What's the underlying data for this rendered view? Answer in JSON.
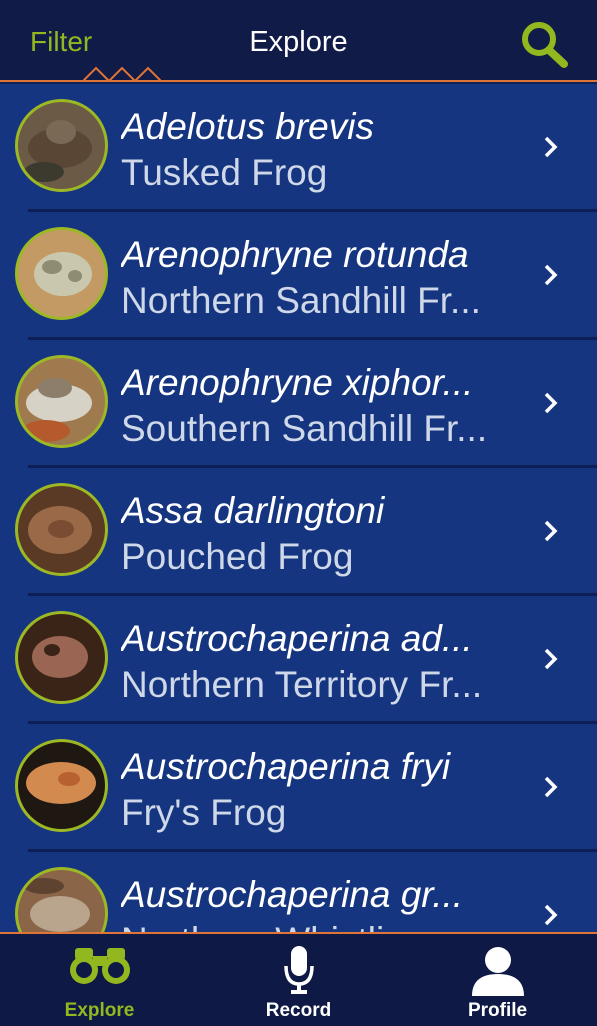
{
  "header": {
    "filter_label": "Filter",
    "title": "Explore",
    "search_icon": "search-icon"
  },
  "colors": {
    "accent_green": "#93b81f",
    "accent_orange": "#e07436",
    "list_background": "#163580",
    "header_background": "#101b48"
  },
  "species": [
    {
      "scientific": "Adelotus brevis",
      "common": "Tusked Frog"
    },
    {
      "scientific": "Arenophryne rotunda",
      "common": "Northern Sandhill Fr..."
    },
    {
      "scientific": "Arenophryne xiphor...",
      "common": "Southern Sandhill Fr..."
    },
    {
      "scientific": "Assa darlingtoni",
      "common": "Pouched Frog"
    },
    {
      "scientific": "Austrochaperina ad...",
      "common": "Northern Territory Fr..."
    },
    {
      "scientific": "Austrochaperina fryi",
      "common": "Fry's Frog"
    },
    {
      "scientific": "Austrochaperina gr...",
      "common": "Northern Whistling..."
    }
  ],
  "tabbar": {
    "tabs": [
      {
        "label": "Explore",
        "icon": "binoculars-icon",
        "active": true
      },
      {
        "label": "Record",
        "icon": "microphone-icon",
        "active": false
      },
      {
        "label": "Profile",
        "icon": "person-icon",
        "active": false
      }
    ]
  }
}
